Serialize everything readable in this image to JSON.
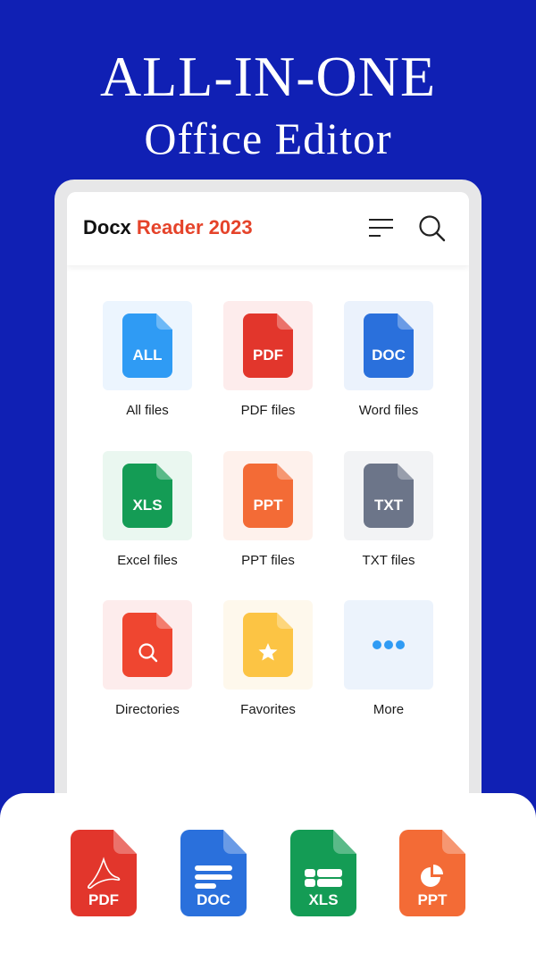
{
  "promo": {
    "headline": "ALL-IN-ONE",
    "subheadline": "Office Editor"
  },
  "app": {
    "title_part1": "Docx",
    "title_part2": "Reader 2023",
    "colors": {
      "background": "#1020b4",
      "accent": "#e5432a"
    }
  },
  "categories": [
    {
      "label": "All files",
      "badge": "ALL",
      "color": "#2f9bf4",
      "bg": "#ecf5fe"
    },
    {
      "label": "PDF files",
      "badge": "PDF",
      "color": "#e2362c",
      "bg": "#fdecec"
    },
    {
      "label": "Word files",
      "badge": "DOC",
      "color": "#2a70dc",
      "bg": "#ebf2fc"
    },
    {
      "label": "Excel files",
      "badge": "XLS",
      "color": "#149c55",
      "bg": "#eaf7f0"
    },
    {
      "label": "PPT files",
      "badge": "PPT",
      "color": "#f36b36",
      "bg": "#fef1ec"
    },
    {
      "label": "TXT files",
      "badge": "TXT",
      "color": "#6c7589",
      "bg": "#f2f3f5"
    },
    {
      "label": "Directories",
      "badge": "",
      "icon": "search-icon",
      "color": "#ef4630",
      "bg": "#fdecec"
    },
    {
      "label": "Favorites",
      "badge": "",
      "icon": "star-icon",
      "color": "#fcc444",
      "bg": "#fef8ec"
    },
    {
      "label": "More",
      "badge": "",
      "icon": "more-dots-icon",
      "color": "#2f9bf4",
      "bg": "#ecf3fc"
    }
  ],
  "formats": [
    {
      "label": "PDF",
      "icon": "acrobat-icon",
      "color": "#e2362c"
    },
    {
      "label": "DOC",
      "icon": "text-lines-icon",
      "color": "#2a70dc"
    },
    {
      "label": "XLS",
      "icon": "table-icon",
      "color": "#149c55"
    },
    {
      "label": "PPT",
      "icon": "pie-chart-icon",
      "color": "#f36b36"
    }
  ]
}
